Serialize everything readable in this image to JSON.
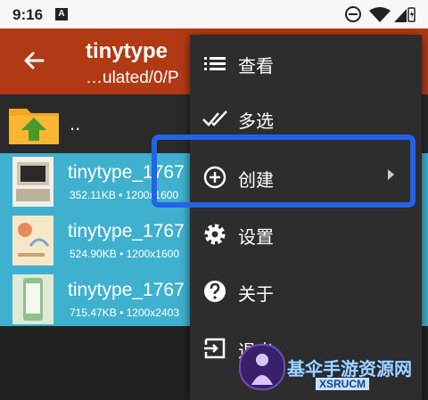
{
  "status_bar": {
    "time": "9:16",
    "badge": "A"
  },
  "app_bar": {
    "title": "tinytype",
    "path": "…ulated/0/P"
  },
  "file_list": {
    "parent_label": "..",
    "files": [
      {
        "name": "tinytype_1767",
        "size": "352.11KB",
        "dims": "1200x1600",
        "thumb": "computer"
      },
      {
        "name": "tinytype_1767",
        "size": "524.90KB",
        "dims": "1200x1600",
        "thumb": "poster"
      },
      {
        "name": "tinytype_1767",
        "size": "715.47KB",
        "dims": "1200x2403",
        "thumb": "phone"
      }
    ],
    "separator": "•"
  },
  "menu": {
    "items": [
      {
        "label": "查看",
        "icon": "list-icon"
      },
      {
        "label": "多选",
        "icon": "double-check-icon"
      },
      {
        "label": "创建",
        "icon": "add-circle-icon",
        "has_submenu": true
      },
      {
        "label": "设置",
        "icon": "gear-icon"
      },
      {
        "label": "关于",
        "icon": "help-circle-icon"
      },
      {
        "label": "退出",
        "icon": "exit-icon"
      }
    ]
  },
  "watermark": {
    "text": "基伞手游资源网",
    "sub": "XSRUCM"
  },
  "colors": {
    "app_bar": "#b13a14",
    "selected_row": "#3fb1cf",
    "menu_bg": "#2d2d2d",
    "highlight": "#2462ea"
  }
}
